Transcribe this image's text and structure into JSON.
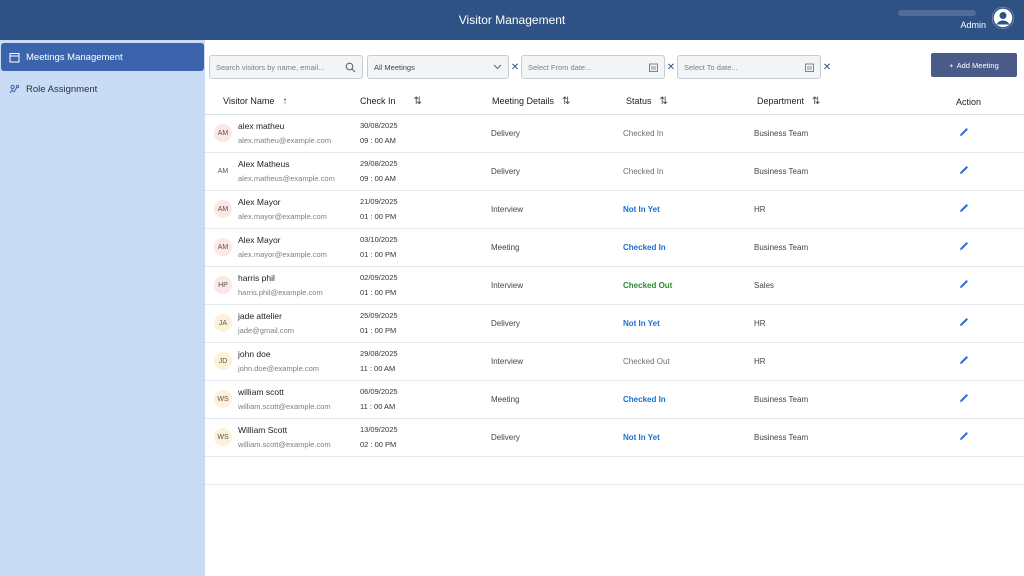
{
  "header": {
    "title": "Visitor Management",
    "user_role": "Admin"
  },
  "sidebar": {
    "items": [
      {
        "label": "Meetings Management",
        "icon": "calendar-icon",
        "active": true
      },
      {
        "label": "Role Assignment",
        "icon": "role-icon",
        "active": false
      }
    ]
  },
  "filters": {
    "search_placeholder": "Search visitors by name, email...",
    "meeting_select": "All Meetings",
    "from_placeholder": "Select From date...",
    "to_placeholder": "Select To date..."
  },
  "add_button": "Add Meeting",
  "table": {
    "headers": [
      "Visitor Name",
      "Check In",
      "Meeting Details",
      "Status",
      "Department",
      "Action"
    ],
    "rows": [
      {
        "initials": "AM",
        "name": "alex matheu",
        "email": "alex.matheu@example.com",
        "date": "30/08/2025",
        "time": "09 : 00 AM",
        "meeting": "Delivery",
        "status": "Checked In",
        "status_style": "grey",
        "department": "Business Team",
        "badge": "#fde7e4"
      },
      {
        "initials": "AM",
        "name": "Alex Matheus",
        "email": "alex.matheus@example.com",
        "date": "29/08/2025",
        "time": "09 : 00 AM",
        "meeting": "Delivery",
        "status": "Checked In",
        "status_style": "grey",
        "department": "Business Team",
        "badge": "#ffffff"
      },
      {
        "initials": "AM",
        "name": "Alex Mayor",
        "email": "alex.mayor@example.com",
        "date": "21/09/2025",
        "time": "01 : 00 PM",
        "meeting": "Interview",
        "status": "Not In Yet",
        "status_style": "blue",
        "department": "HR",
        "badge": "#fde7e4"
      },
      {
        "initials": "AM",
        "name": "Alex Mayor",
        "email": "alex.mayor@example.com",
        "date": "03/10/2025",
        "time": "01 : 00 PM",
        "meeting": "Meeting",
        "status": "Checked In",
        "status_style": "blue",
        "department": "Business Team",
        "badge": "#fde7e4"
      },
      {
        "initials": "HP",
        "name": "harris phil",
        "email": "harris.phil@example.com",
        "date": "02/09/2025",
        "time": "01 : 00 PM",
        "meeting": "Interview",
        "status": "Checked Out",
        "status_style": "green",
        "department": "Sales",
        "badge": "#fde7e4"
      },
      {
        "initials": "JA",
        "name": "jade attelier",
        "email": "jade@gmail.com",
        "date": "25/09/2025",
        "time": "01 : 00 PM",
        "meeting": "Delivery",
        "status": "Not In Yet",
        "status_style": "blue",
        "department": "HR",
        "badge": "#fdf2d8"
      },
      {
        "initials": "JD",
        "name": "john doe",
        "email": "john.doe@example.com",
        "date": "29/08/2025",
        "time": "11 : 00 AM",
        "meeting": "Interview",
        "status": "Checked Out",
        "status_style": "grey",
        "department": "HR",
        "badge": "#fdf2d8"
      },
      {
        "initials": "WS",
        "name": "william scott",
        "email": "william.scott@example.com",
        "date": "06/09/2025",
        "time": "11 : 00 AM",
        "meeting": "Meeting",
        "status": "Checked In",
        "status_style": "blue",
        "department": "Business Team",
        "badge": "#fdf2d8"
      },
      {
        "initials": "WS",
        "name": "William Scott",
        "email": "william.scott@example.com",
        "date": "13/09/2025",
        "time": "02 : 00 PM",
        "meeting": "Delivery",
        "status": "Not In Yet",
        "status_style": "blue",
        "department": "Business Team",
        "badge": "#fdf2d8"
      }
    ]
  },
  "colors": {
    "topbar": "#2f5285",
    "sidebar": "#c9dcf3",
    "active_item": "#3b64ac",
    "edit_icon": "#2f6fd1"
  }
}
